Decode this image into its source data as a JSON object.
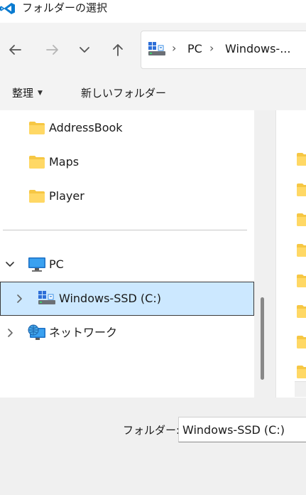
{
  "window": {
    "title": "フォルダーの選択",
    "app_icon": "vscode-icon",
    "accent": "#0078d4"
  },
  "navbar": {
    "back_icon": "arrow-left-icon",
    "forward_icon": "arrow-right-icon",
    "recent_icon": "chevron-down-icon",
    "up_icon": "arrow-up-icon",
    "address": {
      "segments": [
        "PC",
        "Windows-..."
      ],
      "separator": "›"
    }
  },
  "commandbar": {
    "organize_label": "整理",
    "organize_caret": "▼",
    "new_folder_label": "新しいフォルダー"
  },
  "navpane": {
    "items": [
      {
        "label": "AddressBook",
        "icon": "folder-icon"
      },
      {
        "label": "Maps",
        "icon": "folder-icon"
      },
      {
        "label": "Player",
        "icon": "folder-icon"
      },
      {
        "label": "PC",
        "icon": "monitor-icon",
        "expanded": true
      },
      {
        "label": "Windows-SSD (C:)",
        "icon": "drive-icon",
        "selected": true
      },
      {
        "label": "ネットワーク",
        "icon": "network-icon"
      }
    ],
    "selection_color": "#cce8ff"
  },
  "bottom": {
    "folder_label": "フォルダー:",
    "folder_value": "Windows-SSD (C:)"
  }
}
